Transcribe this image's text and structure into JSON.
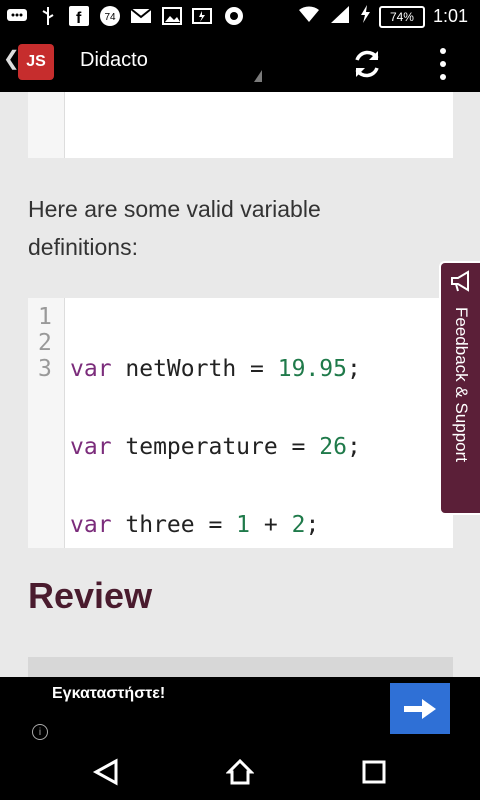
{
  "status_bar": {
    "notification_badge": "74",
    "battery": "74%",
    "time": "1:01"
  },
  "app_bar": {
    "logo_text": "JS",
    "title": "Didacto"
  },
  "content": {
    "paragraph": "Here are some valid variable definitions:",
    "code": {
      "lines": [
        {
          "num": "1",
          "kw": "var",
          "name": " netWorth = ",
          "value": "19.95",
          "end": ";"
        },
        {
          "num": "2",
          "kw": "var",
          "name": " temperature = ",
          "value": "26",
          "end": ";"
        },
        {
          "num": "3",
          "kw": "var",
          "name": " three = ",
          "value": "1",
          "op": " + ",
          "value2": "2",
          "end": ";"
        }
      ]
    },
    "section_title": "Review"
  },
  "feedback_tab": {
    "label": "Feedback & Support"
  },
  "ad": {
    "text": "Εγκαταστήστε!",
    "info_label": "i"
  },
  "colors": {
    "brand_maroon": "#5b1f38",
    "keyword": "#7b2c7b",
    "number": "#1f7a4a",
    "ad_button": "#2f70d6"
  }
}
